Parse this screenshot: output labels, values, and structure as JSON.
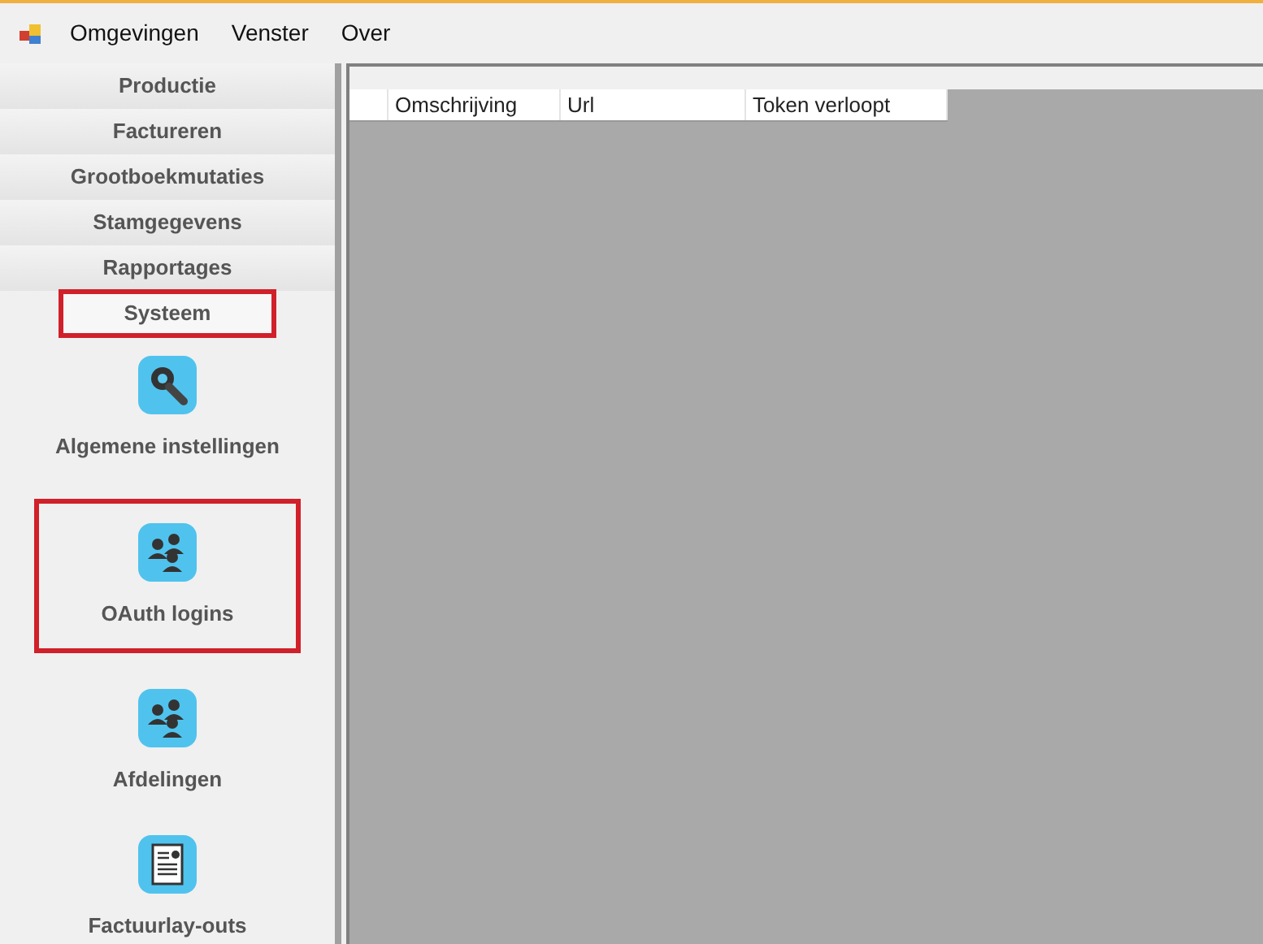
{
  "menu_bar": {
    "items": [
      "Omgevingen",
      "Venster",
      "Over"
    ]
  },
  "sidebar": {
    "sections": [
      {
        "label": "Productie",
        "selected": false,
        "highlighted": false
      },
      {
        "label": "Factureren",
        "selected": false,
        "highlighted": false
      },
      {
        "label": "Grootboekmutaties",
        "selected": false,
        "highlighted": false
      },
      {
        "label": "Stamgegevens",
        "selected": false,
        "highlighted": false
      },
      {
        "label": "Rapportages",
        "selected": false,
        "highlighted": false
      },
      {
        "label": "Systeem",
        "selected": true,
        "highlighted": true
      }
    ],
    "items": [
      {
        "label": "Algemene instellingen",
        "kind": "wrench",
        "highlighted": false
      },
      {
        "label": "OAuth logins",
        "kind": "people",
        "highlighted": true
      },
      {
        "label": "Afdelingen",
        "kind": "people",
        "highlighted": false
      },
      {
        "label": "Factuurlay-outs",
        "kind": "document",
        "highlighted": false
      }
    ]
  },
  "table": {
    "columns": [
      "Omschrijving",
      "Url",
      "Token verloopt"
    ]
  }
}
